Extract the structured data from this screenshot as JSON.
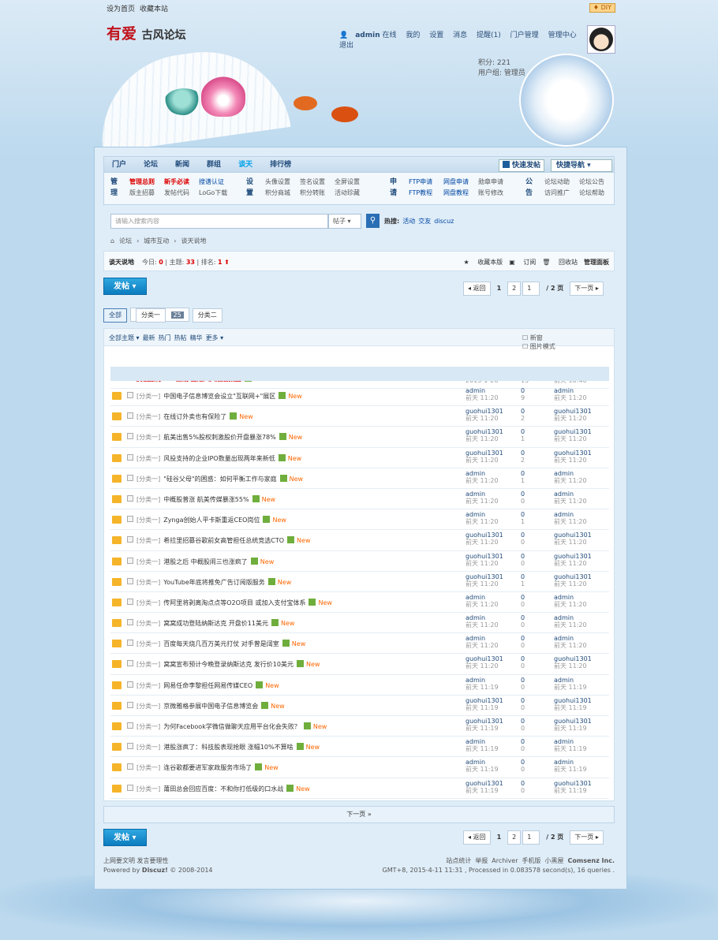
{
  "topbar": {
    "set_home": "设为首页",
    "bookmark": "收藏本站",
    "diy": "♦ DIY"
  },
  "logo": {
    "text_a": "有爱",
    "text_b": "古风论坛"
  },
  "user": {
    "username": "admin",
    "status": "在线",
    "links": [
      "我的",
      "设置",
      "消息",
      "提醒(1)",
      "门户管理",
      "管理中心",
      "退出"
    ],
    "points": "积分: 221",
    "group": "用户组: 管理员"
  },
  "nav": {
    "items": [
      "门户",
      "论坛",
      "新闻",
      "群组",
      "谈天",
      "排行榜"
    ],
    "current": "谈天",
    "fast_post": "快速发帖",
    "quick_nav": "快捷导航 ▾"
  },
  "quick": [
    {
      "head": "管理",
      "items": [
        {
          "t": "管理总则",
          "c": "red"
        },
        {
          "t": "新手必读",
          "c": "red"
        },
        {
          "t": "搜谱认证",
          "c": "blue"
        },
        {
          "t": "版主招募",
          "c": ""
        },
        {
          "t": "发帖代码",
          "c": ""
        },
        {
          "t": "LoGo下载",
          "c": ""
        }
      ]
    },
    {
      "head": "设置",
      "items": [
        {
          "t": "头像设置",
          "c": ""
        },
        {
          "t": "签名设置",
          "c": ""
        },
        {
          "t": "全屏设置",
          "c": ""
        },
        {
          "t": "积分商城",
          "c": ""
        },
        {
          "t": "积分转账",
          "c": ""
        },
        {
          "t": "活动珍藏",
          "c": ""
        }
      ]
    },
    {
      "head": "申请",
      "items": [
        {
          "t": "FTP申请",
          "c": "blue"
        },
        {
          "t": "网盘申请",
          "c": "blue"
        },
        {
          "t": "勋章申请",
          "c": ""
        },
        {
          "t": "FTP教程",
          "c": "blue"
        },
        {
          "t": "网盘教程",
          "c": "blue"
        },
        {
          "t": "账号修改",
          "c": ""
        }
      ]
    },
    {
      "head": "公告",
      "items": [
        {
          "t": "论坛动助",
          "c": ""
        },
        {
          "t": "论坛公告",
          "c": ""
        },
        {
          "t": "访问推广",
          "c": ""
        },
        {
          "t": "论坛帮助",
          "c": ""
        }
      ]
    }
  ],
  "search": {
    "placeholder": "请输入搜索内容",
    "type": "帖子 ▾",
    "hot_label": "热搜:",
    "hot": [
      "活动",
      "交友",
      "discuz"
    ]
  },
  "breadcrumb": [
    "论坛",
    "城市互动",
    "谈天说地"
  ],
  "board": {
    "name": "谈天说地",
    "today_label": "今日:",
    "today": "0",
    "topics_label": "主题:",
    "topics": "33",
    "rank_label": "排名:",
    "rank": "1",
    "fav": "收藏本版",
    "rss": "订阅",
    "recycle": "回收站",
    "manage": "管理面板"
  },
  "post_btn": "发帖",
  "pager": {
    "prev": "◂ 返回",
    "pages": [
      "1",
      "2"
    ],
    "input": "1",
    "total": "/ 2 页",
    "next": "下一页 ▸"
  },
  "tabs": [
    {
      "label": "全部"
    },
    {
      "label": "分类一",
      "count": "25"
    },
    {
      "label": "分类二"
    }
  ],
  "thead": {
    "filters": [
      "全部主题 ▾",
      "最新",
      "热门",
      "热帖",
      "精华",
      "更多 ▾"
    ],
    "newwin": "新窗",
    "picmode": "图片模式"
  },
  "sticky": {
    "title": "腾漫旅行APP上线 直通八大酒店集团",
    "author": "admin",
    "date": "2015-1-26",
    "replies": "2",
    "views": "15",
    "last_user": "guohui1301",
    "last_time": "前天 10:40"
  },
  "threads": [
    {
      "cat": "[分类一]",
      "title": "中国电子信息博览会设立\"互联网+\"展区",
      "author": "admin",
      "time": "前天 11:20",
      "r": "0",
      "v": "9",
      "lu": "admin",
      "lt": "前天 11:20"
    },
    {
      "cat": "[分类一]",
      "title": "在线订外卖也有保险了",
      "author": "guohui1301",
      "time": "前天 11:20",
      "r": "0",
      "v": "2",
      "lu": "guohui1301",
      "lt": "前天 11:20"
    },
    {
      "cat": "[分类一]",
      "title": "航美出售5%股权刺激股价开盘暴涨78%",
      "author": "guohui1301",
      "time": "前天 11:20",
      "r": "0",
      "v": "1",
      "lu": "guohui1301",
      "lt": "前天 11:20"
    },
    {
      "cat": "[分类一]",
      "title": "风投支持的企业IPO数量出现两年来新低",
      "author": "guohui1301",
      "time": "前天 11:20",
      "r": "0",
      "v": "2",
      "lu": "guohui1301",
      "lt": "前天 11:20"
    },
    {
      "cat": "[分类一]",
      "title": "\"硅谷父母\"的困惑：如何平衡工作与家庭",
      "author": "admin",
      "time": "前天 11:20",
      "r": "0",
      "v": "1",
      "lu": "admin",
      "lt": "前天 11:20"
    },
    {
      "cat": "[分类一]",
      "title": "中概股普涨 航美传媒暴涨55%",
      "author": "admin",
      "time": "前天 11:20",
      "r": "0",
      "v": "0",
      "lu": "admin",
      "lt": "前天 11:20"
    },
    {
      "cat": "[分类一]",
      "title": "Zynga创始人平卡斯重返CEO岗位",
      "author": "admin",
      "time": "前天 11:20",
      "r": "0",
      "v": "1",
      "lu": "admin",
      "lt": "前天 11:20"
    },
    {
      "cat": "[分类一]",
      "title": "希拉里招募谷歌前女高管担任总统竞选CTO",
      "author": "guohui1301",
      "time": "前天 11:20",
      "r": "0",
      "v": "0",
      "lu": "guohui1301",
      "lt": "前天 11:20"
    },
    {
      "cat": "[分类一]",
      "title": "港股之后 中概股闹三也涨疯了",
      "author": "guohui1301",
      "time": "前天 11:20",
      "r": "0",
      "v": "0",
      "lu": "guohui1301",
      "lt": "前天 11:20"
    },
    {
      "cat": "[分类一]",
      "title": "YouTube年底将推免广告订阅版服务",
      "author": "guohui1301",
      "time": "前天 11:20",
      "r": "0",
      "v": "1",
      "lu": "guohui1301",
      "lt": "前天 11:20"
    },
    {
      "cat": "[分类一]",
      "title": "传阿里将剥离淘点点等O2O项目 或加入支付宝体系",
      "author": "admin",
      "time": "前天 11:20",
      "r": "0",
      "v": "0",
      "lu": "admin",
      "lt": "前天 11:20"
    },
    {
      "cat": "[分类一]",
      "title": "窝窝成功登陆纳斯达克 开盘价11美元",
      "author": "admin",
      "time": "前天 11:20",
      "r": "0",
      "v": "0",
      "lu": "admin",
      "lt": "前天 11:20"
    },
    {
      "cat": "[分类一]",
      "title": "百度每天烧几百万美元打仗 对手曾是阔室",
      "author": "admin",
      "time": "前天 11:20",
      "r": "0",
      "v": "0",
      "lu": "admin",
      "lt": "前天 11:20"
    },
    {
      "cat": "[分类一]",
      "title": "窝窝宣布预计今晚登录纳斯达克 发行价10美元",
      "author": "guohui1301",
      "time": "前天 11:20",
      "r": "0",
      "v": "0",
      "lu": "guohui1301",
      "lt": "前天 11:20"
    },
    {
      "cat": "[分类一]",
      "title": "网易任命李黎担任网易传媒CEO",
      "author": "admin",
      "time": "前天 11:19",
      "r": "0",
      "v": "0",
      "lu": "admin",
      "lt": "前天 11:19"
    },
    {
      "cat": "[分类一]",
      "title": "京微雅格参展中国电子信息博览会",
      "author": "guohui1301",
      "time": "前天 11:19",
      "r": "0",
      "v": "0",
      "lu": "guohui1301",
      "lt": "前天 11:19"
    },
    {
      "cat": "[分类一]",
      "title": "为何Facebook学微信做聊天应用平台化会失败？",
      "author": "guohui1301",
      "time": "前天 11:19",
      "r": "0",
      "v": "0",
      "lu": "guohui1301",
      "lt": "前天 11:19"
    },
    {
      "cat": "[分类一]",
      "title": "港股涨疯了：科技股表现抢眼 涨幅10%不算啥",
      "author": "admin",
      "time": "前天 11:19",
      "r": "0",
      "v": "0",
      "lu": "admin",
      "lt": "前天 11:19"
    },
    {
      "cat": "[分类一]",
      "title": "连谷歌都要进军家政服务市场了",
      "author": "admin",
      "time": "前天 11:19",
      "r": "0",
      "v": "0",
      "lu": "admin",
      "lt": "前天 11:19"
    },
    {
      "cat": "[分类一]",
      "title": "莆田总会回应百度：不和你打低级的口水战",
      "author": "guohui1301",
      "time": "前天 11:19",
      "r": "0",
      "v": "0",
      "lu": "guohui1301",
      "lt": "前天 11:19"
    }
  ],
  "new_badge": "New",
  "nextpage": "下一页 »",
  "footer": {
    "left1": "上网要文明 发言要理性",
    "left2_pre": "Powered by",
    "left2_brand": "Discuz!",
    "left2_post": "© 2008-2014",
    "links": [
      "站点统计",
      "举报",
      "Archiver",
      "手机版",
      "小黑屋",
      "Comsenz Inc."
    ],
    "stats": "GMT+8, 2015-4-11 11:31 , Processed in 0.083578 second(s), 16 queries ."
  }
}
